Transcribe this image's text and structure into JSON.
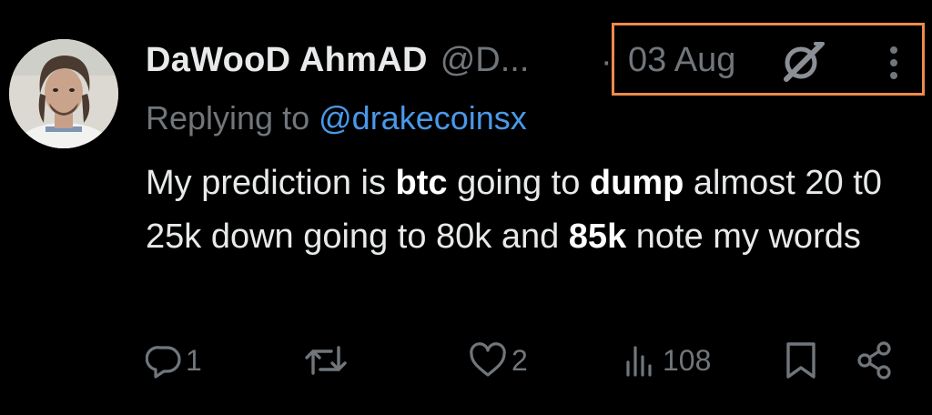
{
  "author": {
    "display_name": "DaWooD AhmAD",
    "handle": "@D..."
  },
  "separator": "·",
  "date": "03 Aug",
  "replying": {
    "prefix": "Replying to",
    "handle": "@drakecoinsx"
  },
  "tweet": {
    "t1": "My prediction is ",
    "b1": "btc",
    "t2": " going to ",
    "b2": "dump",
    "t3": " almost 20 t0 25k down going to 80k and ",
    "b3": "85k",
    "t4": " note my words"
  },
  "actions": {
    "reply_count": "1",
    "retweet_count": "",
    "like_count": "2",
    "view_count": "108"
  },
  "icons": {
    "avatar": "profile-photo",
    "grok": "grok-icon",
    "more": "more-vertical-icon",
    "reply": "reply-icon",
    "retweet": "retweet-icon",
    "like": "heart-icon",
    "views": "views-icon",
    "bookmark": "bookmark-icon",
    "share": "share-icon"
  },
  "colors": {
    "background": "#000000",
    "text": "#e7e9ea",
    "muted": "#71767b",
    "link": "#4a99e9",
    "highlight": "#f08a4b"
  }
}
